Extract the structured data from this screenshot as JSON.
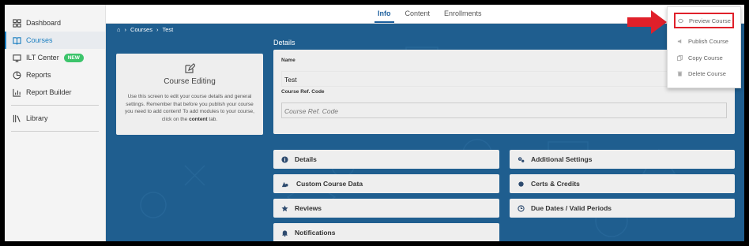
{
  "sidebar": {
    "items": [
      {
        "label": "Dashboard",
        "icon": "dashboard-icon"
      },
      {
        "label": "Courses",
        "icon": "book-icon"
      },
      {
        "label": "ILT Center",
        "icon": "ilt-icon",
        "badge": "NEW"
      },
      {
        "label": "Reports",
        "icon": "pie-chart-icon"
      },
      {
        "label": "Report Builder",
        "icon": "bar-chart-icon"
      },
      {
        "label": "Library",
        "icon": "library-icon"
      }
    ]
  },
  "tabs": [
    {
      "label": "Info"
    },
    {
      "label": "Content"
    },
    {
      "label": "Enrollments"
    }
  ],
  "breadcrumb": {
    "courses": "Courses",
    "current": "Test"
  },
  "info_card": {
    "title": "Course Editing",
    "text_a": "Use this screen to edit your course details and general settings. Remember that before you publish your course you need to add content! To add modules to your course, click on the ",
    "text_bold": "content",
    "text_b": " tab."
  },
  "details": {
    "heading": "Details",
    "name_label": "Name",
    "name_value": "Test",
    "ref_label": "Course Ref. Code",
    "ref_placeholder": "Course Ref. Code"
  },
  "sections": {
    "details": "Details",
    "additional_settings": "Additional Settings",
    "custom_course_data": "Custom Course Data",
    "certs_credits": "Certs & Credits",
    "reviews": "Reviews",
    "due_dates": "Due Dates / Valid Periods",
    "notifications": "Notifications"
  },
  "menu": {
    "preview": "Preview Course",
    "publish": "Publish Course",
    "copy": "Copy Course",
    "delete": "Delete Course"
  },
  "colors": {
    "accent": "#1b7fc1",
    "main_bg": "#1f5e8f",
    "highlight": "#e0202a",
    "badge": "#3cc46b"
  }
}
